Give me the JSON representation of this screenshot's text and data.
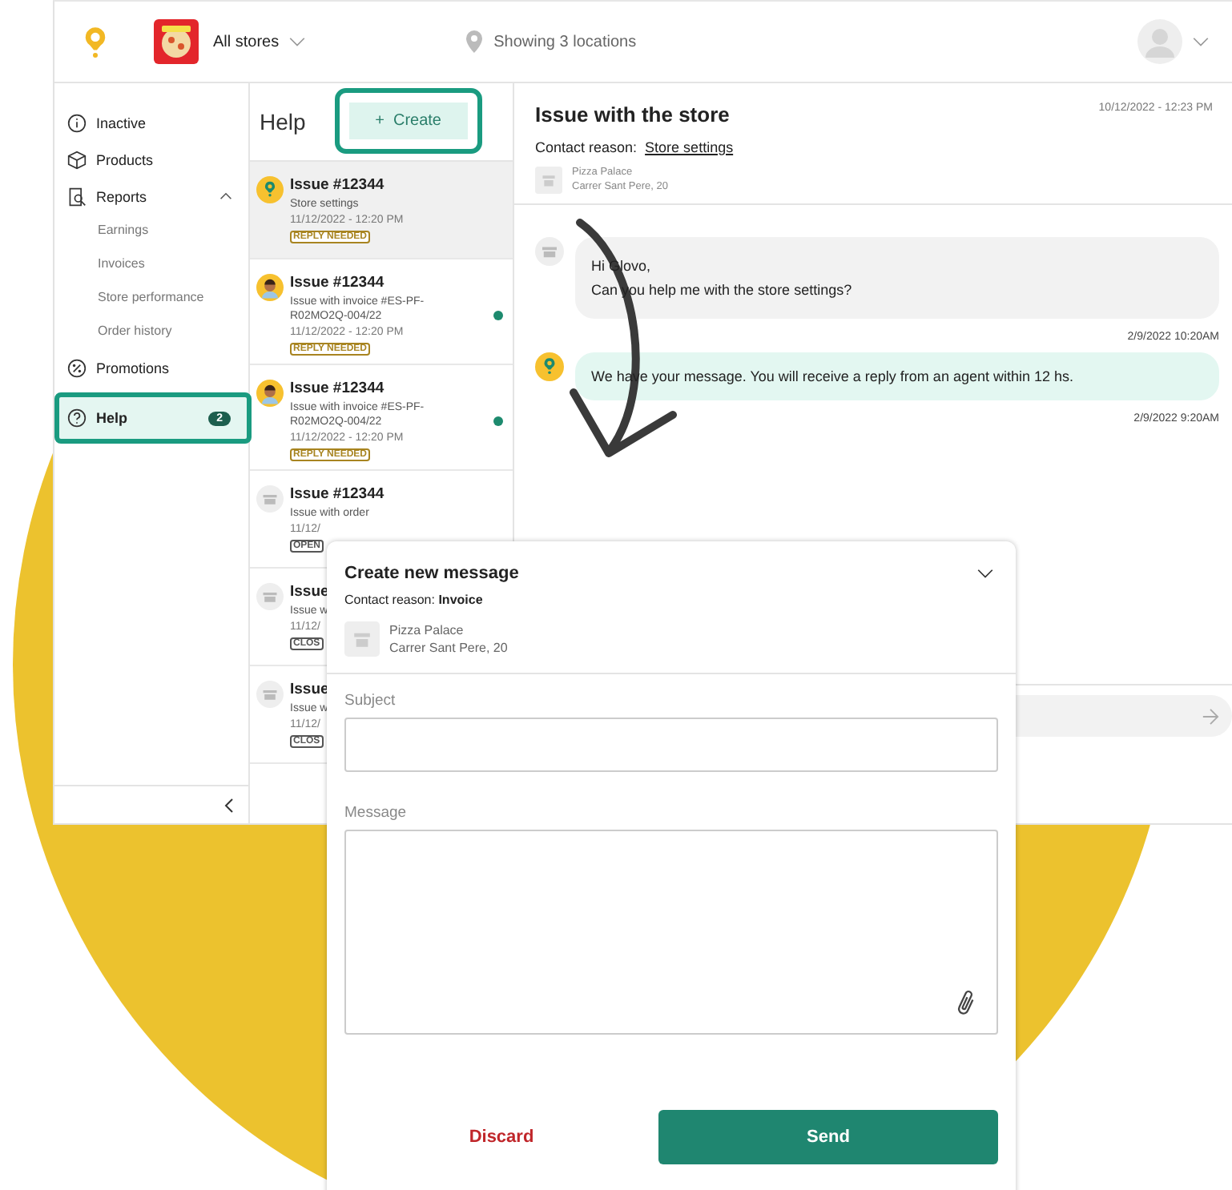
{
  "top_bar": {
    "store_selector": "All stores",
    "location_filter": "Showing 3 locations"
  },
  "sidebar": {
    "items": [
      {
        "label": "Inactive",
        "selected": false,
        "highlighted": false
      },
      {
        "label": "Products",
        "selected": false,
        "highlighted": false
      },
      {
        "label": "Reports",
        "selected": false,
        "highlighted": false,
        "expanded": true,
        "children": [
          {
            "label": "Earnings"
          },
          {
            "label": "Invoices"
          },
          {
            "label": "Store performance"
          },
          {
            "label": "Order history"
          }
        ]
      },
      {
        "label": "Promotions",
        "selected": false,
        "highlighted": false
      },
      {
        "label": "Help",
        "selected": true,
        "highlighted": true,
        "badge": "2"
      }
    ]
  },
  "issues": {
    "title": "Help",
    "create_button": {
      "label": "Create",
      "icon": "+",
      "highlighted": true
    },
    "items": [
      {
        "kind": "brand",
        "title": "Issue #12344",
        "subtitle": "Store settings",
        "date": "11/12/2022 - 12:20 PM",
        "status": "REPLY NEEDED",
        "color": "#a88420",
        "unread": false,
        "selected": true
      },
      {
        "kind": "agent",
        "title": "Issue #12344",
        "subtitle": "Issue with invoice #ES-PF-R02MO2Q-004/22",
        "date": "11/12/2022 - 12:20 PM",
        "status": "REPLY NEEDED",
        "color": "#a88420",
        "unread": true,
        "selected": false
      },
      {
        "kind": "agent",
        "title": "Issue #12344",
        "subtitle": "Issue with invoice #ES-PF-R02MO2Q-004/22",
        "date": "11/12/2022 - 12:20 PM",
        "status": "REPLY NEEDED",
        "color": "#a88420",
        "unread": true,
        "selected": false
      },
      {
        "kind": "store",
        "title": "Issue #12344",
        "subtitle": "Issue with order",
        "date": "11/12/",
        "status": "OPEN",
        "color": "#555555",
        "unread": false,
        "selected": false
      },
      {
        "kind": "store",
        "title": "Issue",
        "subtitle": "Issue w",
        "date": "11/12/",
        "status": "CLOS",
        "color": "#555555",
        "unread": false,
        "selected": false
      },
      {
        "kind": "store",
        "title": "Issue",
        "subtitle": "Issue w",
        "date": "11/12/",
        "status": "CLOS",
        "color": "#555555",
        "unread": false,
        "selected": false
      }
    ]
  },
  "conversation": {
    "title": "Issue with the store",
    "timestamp": "10/12/2022 - 12:23 PM",
    "contact_reason_label": "Contact reason:",
    "contact_reason": "Store settings",
    "store_name": "Pizza Palace",
    "store_address": "Carrer Sant Pere, 20",
    "messages": [
      {
        "kind": "store",
        "lines": [
          "Hi Glovo,",
          "Can you help me with the store settings?"
        ],
        "time": "2/9/2022 10:20AM"
      },
      {
        "kind": "brand",
        "lines": [
          "We have your message. You will receive a reply from an agent within 12 hs."
        ],
        "time": "2/9/2022 9:20AM"
      }
    ]
  },
  "new_message_dialog": {
    "title": "Create new message",
    "contact_reason": "Contact reason: **Invoice**",
    "store_name": "Pizza Palace",
    "store_address": "Carrer Sant Pere, 20",
    "subject_label": "Subject",
    "message_label": "Message",
    "discard_button": "Discard",
    "send_button": "Send"
  }
}
